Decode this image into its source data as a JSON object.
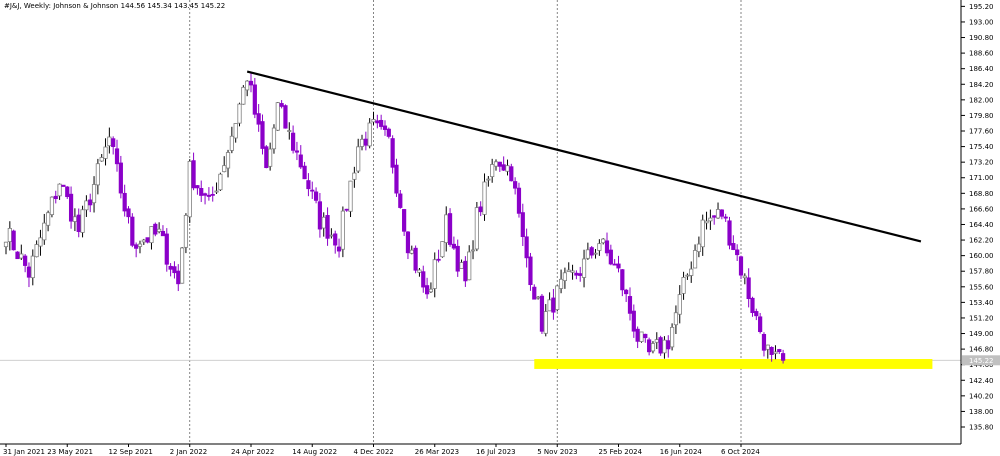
{
  "header": {
    "symbol": "#J&J",
    "timeframe": "Weekly:",
    "name": "Johnson & Johnson",
    "ohlc": "144.56 145.34 143.45 145.22"
  },
  "colors": {
    "bull_candle": "#7f7f7f",
    "bear_candle": "#8b00c9",
    "trendline": "#000000",
    "support_zone": "#ffff00",
    "grid": "#c8c8c8",
    "price_tag_bg": "#c0c0c0"
  },
  "chart_data": {
    "type": "candlestick",
    "symbol": "#J&J",
    "interval": "Weekly",
    "ylim": [
      133.4,
      196.1
    ],
    "current_price": 145.22,
    "y_ticks": [
      "195.20",
      "193.00",
      "190.80",
      "188.60",
      "186.40",
      "184.20",
      "182.00",
      "179.80",
      "177.60",
      "175.40",
      "173.20",
      "171.00",
      "168.80",
      "166.60",
      "164.40",
      "162.20",
      "160.00",
      "157.80",
      "155.60",
      "153.40",
      "151.20",
      "149.00",
      "146.80",
      "144.60",
      "142.40",
      "140.20",
      "138.00",
      "135.80"
    ],
    "x_ticks": [
      "31 Jan 2021",
      "23 May 2021",
      "12 Sep 2021",
      "2 Jan 2022",
      "24 Apr 2022",
      "14 Aug 2022",
      "4 Dec 2022",
      "26 Mar 2023",
      "16 Jul 2023",
      "5 Nov 2023",
      "25 Feb 2024",
      "16 Jun 2024",
      "6 Oct 2024"
    ],
    "vertical_separators": [
      "2 Jan 2022",
      "4 Dec 2022",
      "5 Nov 2023",
      "6 Oct 2024"
    ],
    "candle_anchors": [
      {
        "date": "2021-01-31",
        "close": 163.5
      },
      {
        "date": "2021-03-14",
        "close": 157.5
      },
      {
        "date": "2021-05-09",
        "close": 170.5
      },
      {
        "date": "2021-06-13",
        "close": 163.5
      },
      {
        "date": "2021-08-08",
        "close": 176.5
      },
      {
        "date": "2021-09-19",
        "close": 162.0
      },
      {
        "date": "2021-11-07",
        "close": 163.0
      },
      {
        "date": "2021-12-12",
        "close": 156.0
      },
      {
        "date": "2022-01-02",
        "close": 172.0
      },
      {
        "date": "2022-02-06",
        "close": 167.0
      },
      {
        "date": "2022-03-13",
        "close": 175.0
      },
      {
        "date": "2022-04-17",
        "close": 185.5
      },
      {
        "date": "2022-05-22",
        "close": 172.0
      },
      {
        "date": "2022-06-12",
        "close": 181.0
      },
      {
        "date": "2022-07-24",
        "close": 173.0
      },
      {
        "date": "2022-08-28",
        "close": 165.0
      },
      {
        "date": "2022-10-02",
        "close": 162.0
      },
      {
        "date": "2022-11-06",
        "close": 175.5
      },
      {
        "date": "2022-12-04",
        "close": 178.0
      },
      {
        "date": "2023-01-01",
        "close": 176.0
      },
      {
        "date": "2023-02-05",
        "close": 162.0
      },
      {
        "date": "2023-03-12",
        "close": 154.0
      },
      {
        "date": "2023-04-16",
        "close": 164.5
      },
      {
        "date": "2023-05-21",
        "close": 156.0
      },
      {
        "date": "2023-06-11",
        "close": 165.5
      },
      {
        "date": "2023-07-16",
        "close": 174.0
      },
      {
        "date": "2023-08-13",
        "close": 172.0
      },
      {
        "date": "2023-09-03",
        "close": 162.0
      },
      {
        "date": "2023-10-08",
        "close": 150.5
      },
      {
        "date": "2023-11-12",
        "close": 155.5
      },
      {
        "date": "2023-12-17",
        "close": 158.0
      },
      {
        "date": "2024-01-21",
        "close": 162.0
      },
      {
        "date": "2024-02-25",
        "close": 157.5
      },
      {
        "date": "2024-03-31",
        "close": 148.5
      },
      {
        "date": "2024-04-21",
        "close": 146.0
      },
      {
        "date": "2024-05-26",
        "close": 148.0
      },
      {
        "date": "2024-06-23",
        "close": 155.5
      },
      {
        "date": "2024-07-28",
        "close": 164.5
      },
      {
        "date": "2024-09-01",
        "close": 166.0
      },
      {
        "date": "2024-09-29",
        "close": 160.0
      },
      {
        "date": "2024-11-03",
        "close": 151.0
      },
      {
        "date": "2024-12-01",
        "close": 145.0
      },
      {
        "date": "2024-12-22",
        "close": 145.2
      }
    ],
    "trendline": {
      "start": {
        "date": "2022-04-17",
        "price": 186.0
      },
      "end": {
        "date": "2025-08-31",
        "price": 162.0
      }
    },
    "support_zone": {
      "start_date": "2023-09-24",
      "end_date": "2025-09-21",
      "upper": 145.4,
      "lower": 144.0
    }
  }
}
